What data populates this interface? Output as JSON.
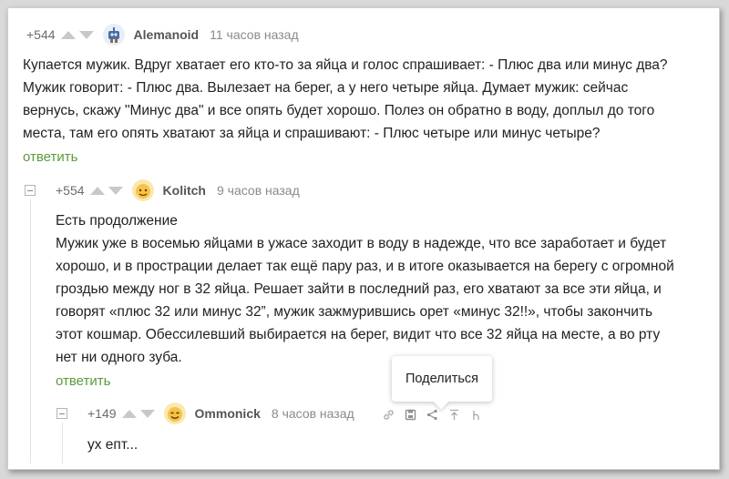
{
  "comments": [
    {
      "rating": "+544",
      "author": "Alemanoid",
      "time": "11 часов назад",
      "avatar_icon": "robot-avatar",
      "lines": [
        "Купается мужик. Вдруг хватает его кто-то за яйца и голос спрашивает: - Плюс два или минус два?",
        "Мужик говорит: - Плюс два. Вылезает на берег, а у него четыре яйца. Думает мужик: сейчас",
        "вернусь, скажу \"Минус два\" и все опять будет хорошо. Полез он обратно в воду, доплыл до того",
        "места, там его опять хватают за яйца и спрашивают: - Плюс четыре или минус четыре?"
      ],
      "reply_label": "ответить"
    },
    {
      "rating": "+554",
      "author": "Kolitch",
      "time": "9 часов назад",
      "avatar_icon": "emoji-face-avatar",
      "lines": [
        "Есть продолжение",
        "Мужик уже в восемью яйцами в ужасе заходит в воду в надежде, что все заработает и будет",
        "хорошо, и в прострации делает так ещё пару раз, и в итоге оказывается на берегу с огромной",
        "гроздью между ног в 32 яйца. Решает зайти в последний раз, его хватают за все эти яйца, и",
        "говорят «плюс 32 или минус 32”, мужик зажмурившись орет «минус 32!!», чтобы закончить",
        "этот кошмар. Обессилевший выбирается на берег, видит что все 32 яйца на месте, а во рту",
        "нет ни одного зуба."
      ],
      "reply_label": "ответить"
    },
    {
      "rating": "+149",
      "author": "Ommonick",
      "time": "8 часов назад",
      "avatar_icon": "emoji-face-avatar",
      "lines": [
        "ух епт..."
      ]
    }
  ],
  "tooltip": {
    "label": "Поделиться"
  },
  "tools": [
    "link-icon",
    "save-icon",
    "share-icon",
    "scroll-up-icon",
    "branch-icon"
  ],
  "colors": {
    "reply": "#5a9b3b",
    "vote": "#c8c8c8",
    "author": "#555555"
  }
}
